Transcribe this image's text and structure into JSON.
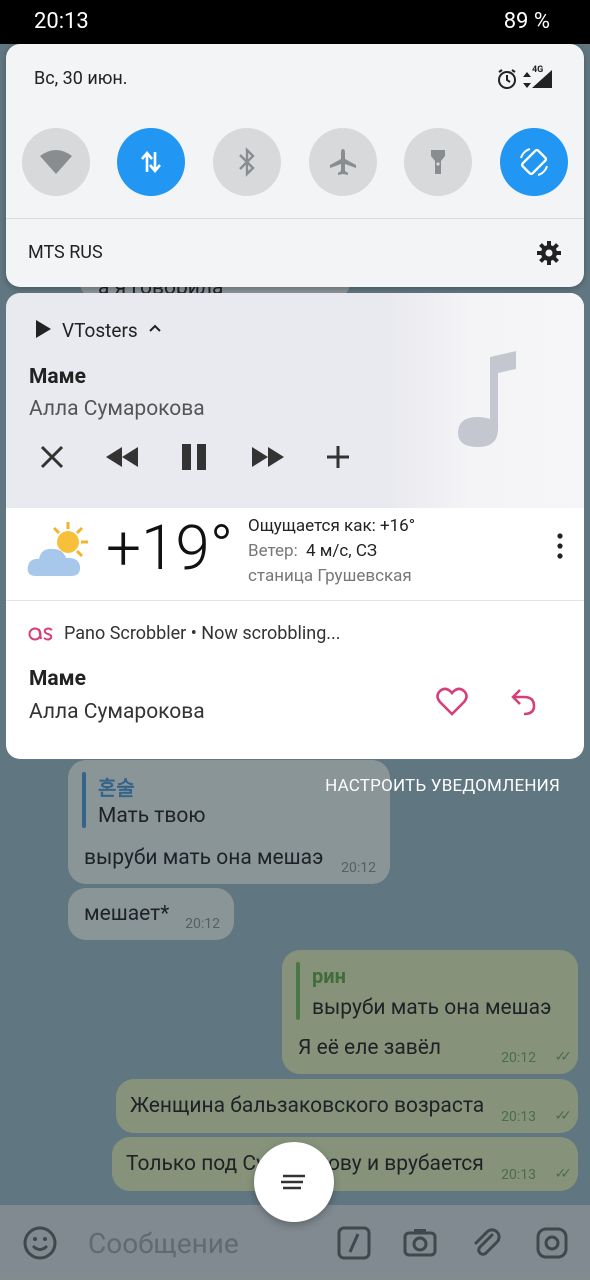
{
  "status_bar": {
    "time": "20:13",
    "battery": "89 %"
  },
  "quick_settings": {
    "date": "Вс, 30 июн.",
    "network_badge": "4G",
    "carrier": "MTS RUS",
    "tiles": [
      {
        "name": "wifi-icon",
        "on": false
      },
      {
        "name": "mobile-data-icon",
        "on": true
      },
      {
        "name": "bluetooth-icon",
        "on": false
      },
      {
        "name": "airplane-icon",
        "on": false
      },
      {
        "name": "flashlight-icon",
        "on": false
      },
      {
        "name": "auto-rotate-icon",
        "on": true
      }
    ],
    "accent_color": "#2196f3"
  },
  "media": {
    "app": "VTosters",
    "title": "Маме",
    "artist": "Алла Сумарокова"
  },
  "weather": {
    "temperature": "+19°",
    "feels_like": "Ощущается как: +16°",
    "wind_label": "Ветер:",
    "wind_value": "4 м/с, СЗ",
    "location": "станица Грушевская"
  },
  "scrobbler": {
    "app": "Pano Scrobbler",
    "status": "Now scrobbling...",
    "title": "Маме",
    "artist": "Алла Сумарокова",
    "accent_color": "#d63f7a"
  },
  "notification_settings": "НАСТРОИТЬ УВЕДОМЛЕНИЯ",
  "chat": {
    "partial_text": "а я говорила",
    "messages": [
      {
        "direction": "in",
        "quote_author": "혼술",
        "quote_text": "Мать твою",
        "text": "выруби мать она мешаэ",
        "time": "20:12"
      },
      {
        "direction": "in",
        "text": "мешает*",
        "time": "20:12"
      },
      {
        "direction": "out",
        "quote_author": "рин",
        "quote_text": "выруби мать она мешаэ",
        "text": "Я её еле завёл",
        "time": "20:12"
      },
      {
        "direction": "out",
        "text": "Женщина бальзаковского возраста",
        "time": "20:13"
      },
      {
        "direction": "out",
        "text": "Только под Сумарокову и врубается",
        "time": "20:13"
      }
    ],
    "input_placeholder": "Сообщение"
  }
}
